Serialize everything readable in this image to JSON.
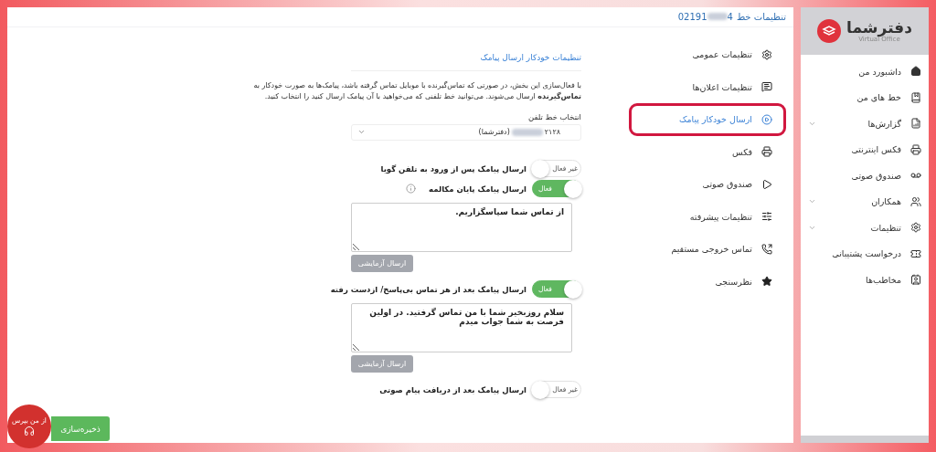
{
  "header": {
    "title": "تنظیمات خط",
    "number_start": "02191",
    "number_end": "4"
  },
  "settings_menu": [
    {
      "label": "تنظیمات عمومی",
      "selected": false
    },
    {
      "label": "تنظیمات اعلان‌ها",
      "selected": false
    },
    {
      "label": "ارسال خودکار پیامک",
      "selected": true
    },
    {
      "label": "فکس",
      "selected": false
    },
    {
      "label": "صندوق صوتی",
      "selected": false
    },
    {
      "label": "تنظیمات پیشرفته",
      "selected": false
    },
    {
      "label": "تماس خروجی مستقیم",
      "selected": false
    },
    {
      "label": "نظرسنجی",
      "selected": false
    }
  ],
  "form": {
    "title": "تنظیمات خودکار ارسال پیامک",
    "description": "با فعال‌سازی این بخش، در صورتی که تماس‌گیرنده با موبایل تماس گرفته باشد، پیامک‌ها به صورت خودکار به **تماس‌گیرنده** ارسال می‌شوند. می‌توانید خط تلفنی که می‌خواهید با آن پیامک ارسال کنید را انتخاب کنید.",
    "line_select": {
      "label": "انتخاب خط تلفن",
      "value_start": "۲۱۲۸",
      "value_end": "(دفترشما)"
    },
    "options": [
      {
        "label": "ارسال پیامک پس از ورود به تلفن گویا",
        "on": false,
        "status": "غیر فعال",
        "info": false
      },
      {
        "label": "ارسال پیامک پایان مکالمه",
        "on": true,
        "status": "فعال",
        "info": true,
        "message": "از تماس شما سپاسگزاریم.",
        "test_button": "ارسال آزمایشی"
      },
      {
        "label": "ارسال پیامک بعد از هر تماس بی‌پاسخ/ ازدست رفته",
        "on": true,
        "status": "فعال",
        "info": false,
        "message": "سلام روزبخیر شما با من تماس گرفتید. در اولین فرصت به شما جواب میدم",
        "test_button": "ارسال آزمایشی"
      },
      {
        "label": "ارسال پیامک بعد از دریافت پیام صوتی",
        "on": false,
        "status": "غیر فعال",
        "info": false
      }
    ],
    "save_button": "ذخیره‌سازی"
  },
  "support_badge": "از من بپرس",
  "sidebar": {
    "logo": {
      "name": "دفترشما",
      "subtitle": "Virtual Office"
    },
    "items": [
      {
        "label": "داشبورد من",
        "expandable": false
      },
      {
        "label": "خط های من",
        "expandable": false
      },
      {
        "label": "گزارش‌ها",
        "expandable": true
      },
      {
        "label": "فکس اینترنتی",
        "expandable": false
      },
      {
        "label": "صندوق صوتی",
        "expandable": false
      },
      {
        "label": "همکاران",
        "expandable": true
      },
      {
        "label": "تنظیمات",
        "expandable": true
      },
      {
        "label": "درخواست پشتیبانی",
        "expandable": false
      },
      {
        "label": "مخاطب‌ها",
        "expandable": false
      }
    ]
  }
}
